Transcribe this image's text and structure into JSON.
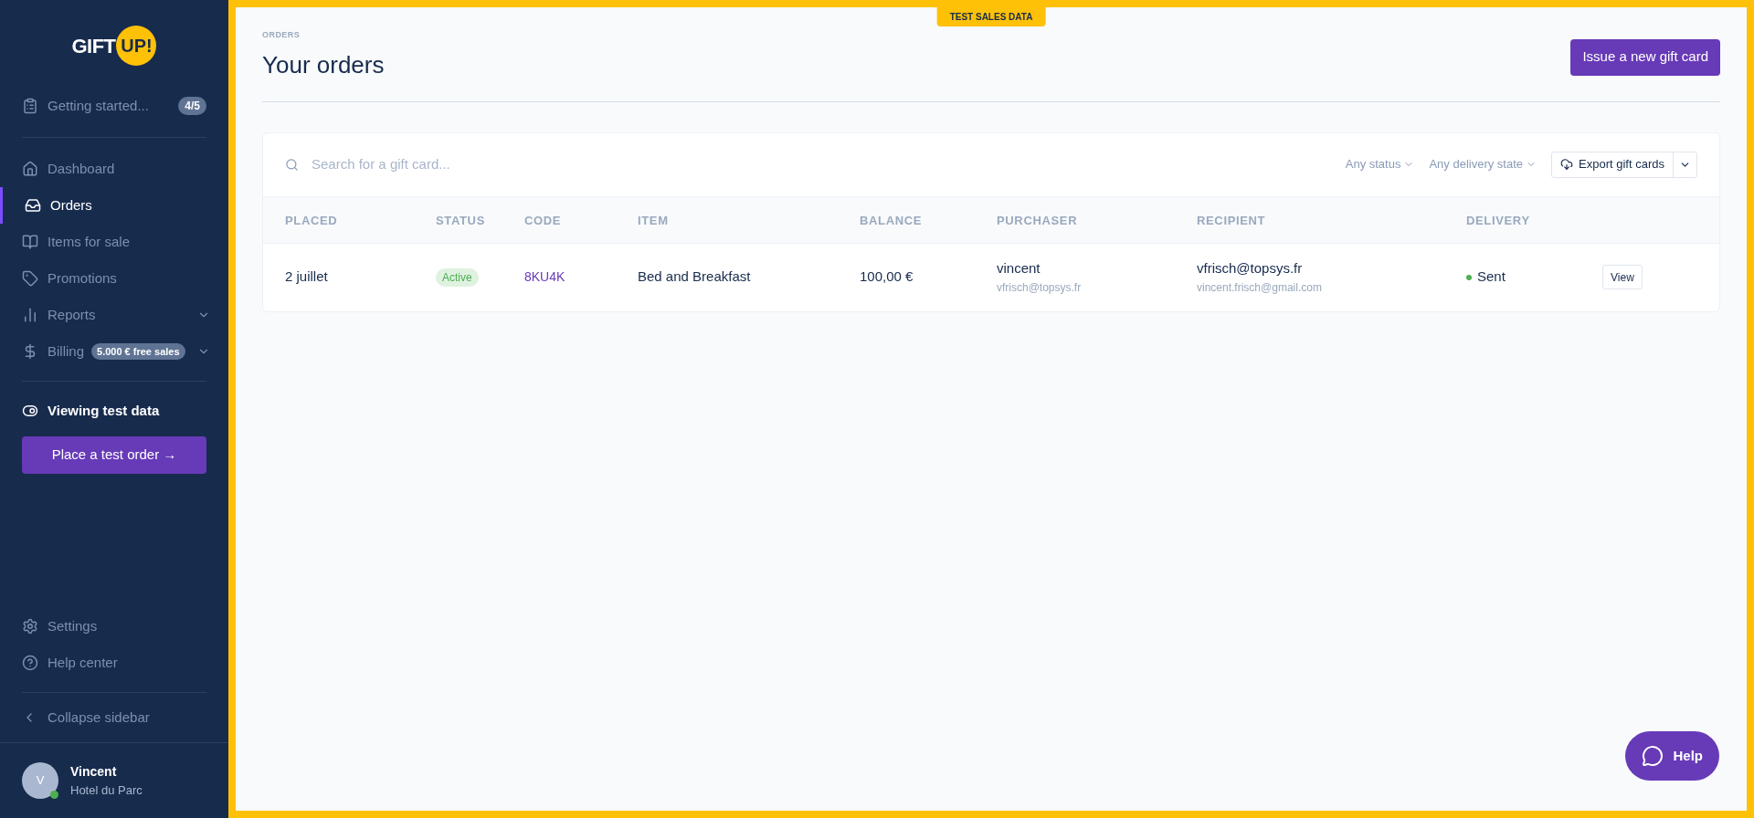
{
  "sidebar": {
    "logo": {
      "word": "GIFT",
      "badge": "UP!"
    },
    "getting_started": {
      "label": "Getting started...",
      "badge": "4/5"
    },
    "items": [
      {
        "label": "Dashboard",
        "selected": false,
        "kind": "link"
      },
      {
        "label": "Orders",
        "selected": true,
        "kind": "link"
      },
      {
        "label": "Items for sale",
        "selected": false,
        "kind": "link"
      },
      {
        "label": "Promotions",
        "selected": false,
        "kind": "link"
      },
      {
        "label": "Reports",
        "selected": false,
        "kind": "menu"
      },
      {
        "label": "Billing",
        "selected": false,
        "kind": "menu",
        "badge": "5.000 € free sales"
      }
    ],
    "test_toggle": {
      "label": "Viewing test data",
      "on": true
    },
    "test_order_button": {
      "label": "Place a test order",
      "arrow": "→"
    },
    "footer_items": [
      {
        "label": "Settings"
      },
      {
        "label": "Help center"
      }
    ],
    "collapse": {
      "label": "Collapse sidebar"
    },
    "user": {
      "initial": "V",
      "name": "Vincent",
      "org": "Hotel du Parc",
      "online": true
    }
  },
  "banner": "TEST SALES DATA",
  "header": {
    "breadcrumb": "ORDERS",
    "title": "Your orders",
    "action": "Issue a new gift card"
  },
  "toolbar": {
    "search": {
      "placeholder": "Search for a gift card..."
    },
    "filters": [
      "Any status",
      "Any delivery state"
    ],
    "export": "Export gift cards"
  },
  "table": {
    "columns": [
      "PLACED",
      "STATUS",
      "CODE",
      "ITEM",
      "BALANCE",
      "PURCHASER",
      "RECIPIENT",
      "DELIVERY"
    ],
    "rows": [
      {
        "placed": "2 juillet",
        "status": "Active",
        "code": "8KU4K",
        "item": "Bed and Breakfast",
        "balance": "100,00 €",
        "purchaser": "vincent",
        "purchaser_email": "vfrisch@topsys.fr",
        "recipient": "vfrisch@topsys.fr",
        "recipient_email": "vincent.frisch@gmail.com",
        "delivery": "Sent",
        "color": "#4caf50",
        "action": "View"
      }
    ]
  },
  "help_button": "Help"
}
